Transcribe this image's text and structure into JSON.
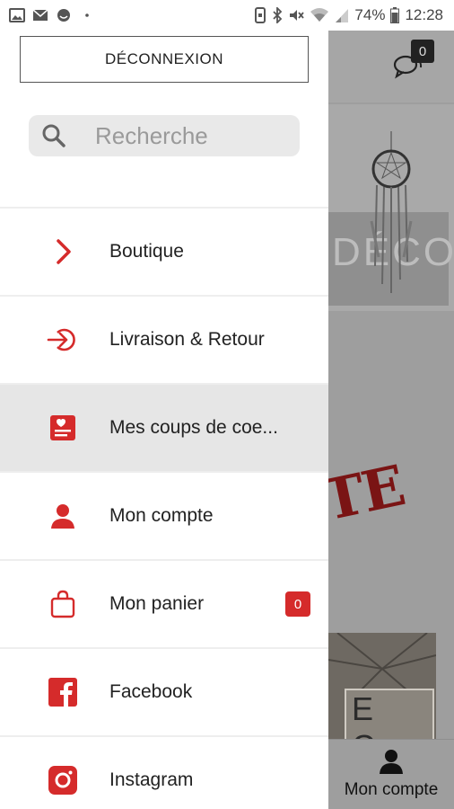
{
  "status_bar": {
    "battery": "74%",
    "time": "12:28",
    "left_icons": [
      "image-icon",
      "mail-icon",
      "emoji-icon",
      "dot-icon"
    ],
    "right_icons": [
      "vibrate-icon",
      "bluetooth-icon",
      "mute-icon",
      "wifi-icon",
      "signal-icon",
      "battery-icon"
    ]
  },
  "background_app": {
    "chat_badge": "0",
    "banner_word": "DÉCO",
    "stamp_word": "TE",
    "photo_letters": "E C O",
    "bottom_tab_label": "Mon compte"
  },
  "drawer": {
    "logout_label": "DÉCONNEXION",
    "search_placeholder": "Recherche",
    "items": [
      {
        "label": "Boutique",
        "icon": "chevron-right-icon"
      },
      {
        "label": "Livraison & Retour",
        "icon": "sign-in-icon"
      },
      {
        "label": "Mes coups de coe...",
        "icon": "favorites-card-icon",
        "active": true
      },
      {
        "label": "Mon compte",
        "icon": "user-icon"
      },
      {
        "label": "Mon panier",
        "icon": "shopping-bag-icon",
        "badge": "0"
      },
      {
        "label": "Facebook",
        "icon": "facebook-icon"
      },
      {
        "label": "Instagram",
        "icon": "instagram-icon"
      }
    ]
  },
  "colors": {
    "accent": "#d52b2b",
    "active_row": "#e6e6e6",
    "overlay": "#9e9e9e"
  }
}
